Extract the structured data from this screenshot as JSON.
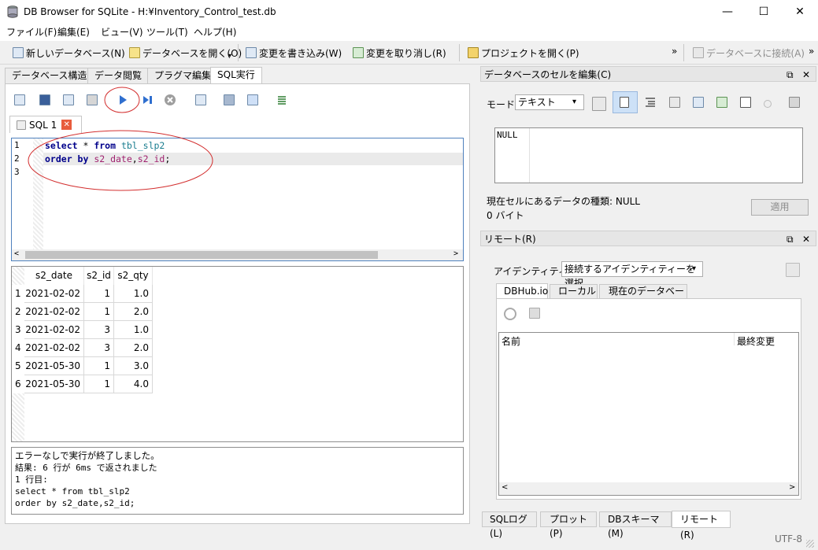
{
  "window": {
    "title": "DB Browser for SQLite - H:¥Inventory_Control_test.db",
    "minimize": "—",
    "maximize": "☐",
    "close": "✕"
  },
  "menu": [
    "ファイル(F)",
    "編集(E)",
    "ビュー(V)",
    "ツール(T)",
    "ヘルプ(H)"
  ],
  "toolbar": {
    "new_db": "新しいデータベース(N)",
    "open_db": "データベースを開く(O)",
    "write_changes": "変更を書き込み(W)",
    "revert_changes": "変更を取り消し(R)",
    "open_project": "プロジェクトを開く(P)",
    "more": "»",
    "connect_db": "データベースに接続(A)",
    "more2": "»"
  },
  "tabs": [
    "データベース構造",
    "データ閲覧",
    "プラグマ編集",
    "SQL実行"
  ],
  "sql_tab": {
    "label": "SQL 1"
  },
  "editor": {
    "line_numbers": [
      "1",
      "2",
      "3"
    ],
    "line1": {
      "kw1": "select",
      "op": " * ",
      "kw2": "from",
      "ident": " tbl_slp2"
    },
    "line2": {
      "kw1": "order by",
      "ident1": " s2_date",
      "comma": ",",
      "ident2": "s2_id",
      "semi": ";"
    }
  },
  "results": {
    "columns": [
      "s2_date",
      "s2_id",
      "s2_qty"
    ],
    "rows": [
      [
        "1",
        "2021-02-02",
        "1",
        "1.0"
      ],
      [
        "2",
        "2021-02-02",
        "1",
        "2.0"
      ],
      [
        "3",
        "2021-02-02",
        "3",
        "1.0"
      ],
      [
        "4",
        "2021-02-02",
        "3",
        "2.0"
      ],
      [
        "5",
        "2021-05-30",
        "1",
        "3.0"
      ],
      [
        "6",
        "2021-05-30",
        "1",
        "4.0"
      ]
    ]
  },
  "messages": [
    "エラーなしで実行が終了しました。",
    "結果: 6 行が 6ms で返されました",
    "1 行目:",
    "select * from tbl_slp2",
    "order by s2_date,s2_id;"
  ],
  "edit_cell_panel": {
    "title": "データベースのセルを編集(C)",
    "mode_label": "モード:",
    "mode_value": "テキスト",
    "cell_value": "NULL",
    "type_info": "現在セルにあるデータの種類: NULL",
    "size_info": "0 バイト",
    "apply": "適用"
  },
  "remote_panel": {
    "title": "リモート(R)",
    "identity_label": "アイデンティティー",
    "identity_value": "接続するアイデンティティーを選択",
    "tabs": [
      "DBHub.io",
      "ローカル",
      "現在のデータベース"
    ],
    "col_name": "名前",
    "col_modified": "最終変更"
  },
  "bottom_tabs": [
    "SQLログ(L)",
    "プロット(P)",
    "DBスキーマ(M)",
    "リモート(R)"
  ],
  "status": {
    "encoding": "UTF-8"
  },
  "dock_controls": {
    "float": "⧉",
    "close": "✕"
  }
}
